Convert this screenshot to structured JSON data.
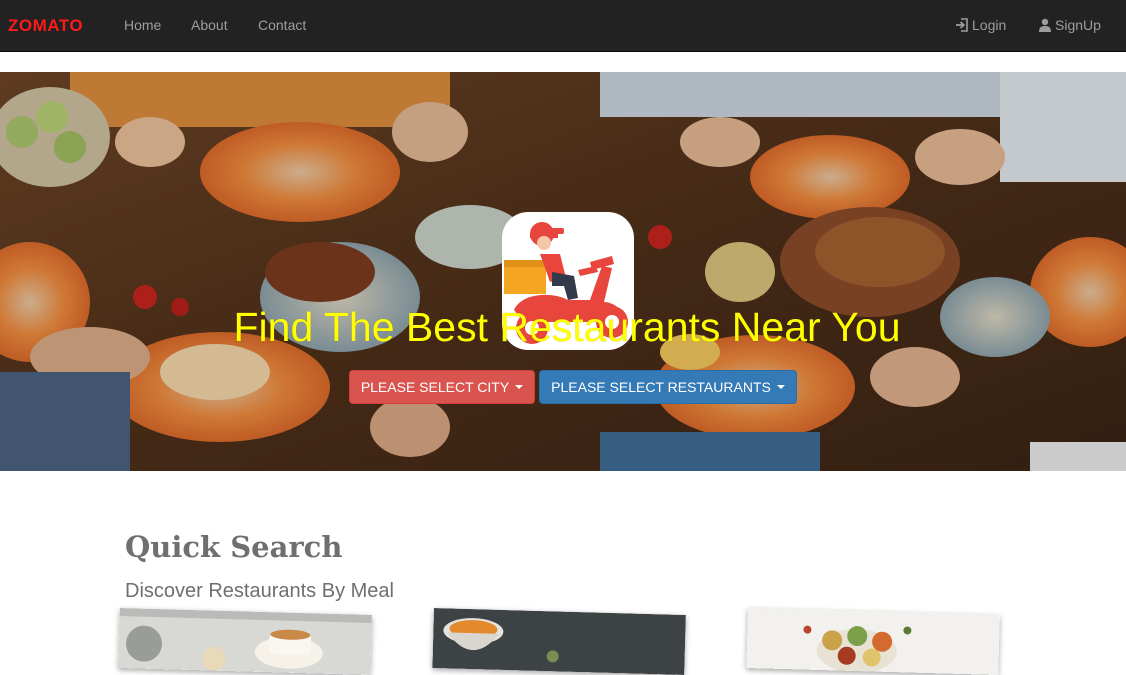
{
  "navbar": {
    "brand": "ZOMATO",
    "links": {
      "home": "Home",
      "about": "About",
      "contact": "Contact"
    },
    "login": "Login",
    "signup": "SignUp",
    "colors": {
      "background": "#222222",
      "brand": "#ff1a1a",
      "link": "#9d9d9d"
    }
  },
  "hero": {
    "title": "Find The Best Restaurants Near You",
    "city_button": "PLEASE SELECT CITY",
    "restaurant_button": "PLEASE SELECT RESTAURANTS",
    "logo_icon": "delivery-scooter-icon",
    "colors": {
      "title": "#ffff00",
      "city_button": "#d9534f",
      "restaurant_button": "#337ab7"
    }
  },
  "quick_search": {
    "title": "Quick Search",
    "subtitle": "Discover Restaurants By Meal",
    "cards": [
      {
        "image": "breakfast-image"
      },
      {
        "image": "soup-image"
      },
      {
        "image": "spices-image"
      }
    ]
  }
}
